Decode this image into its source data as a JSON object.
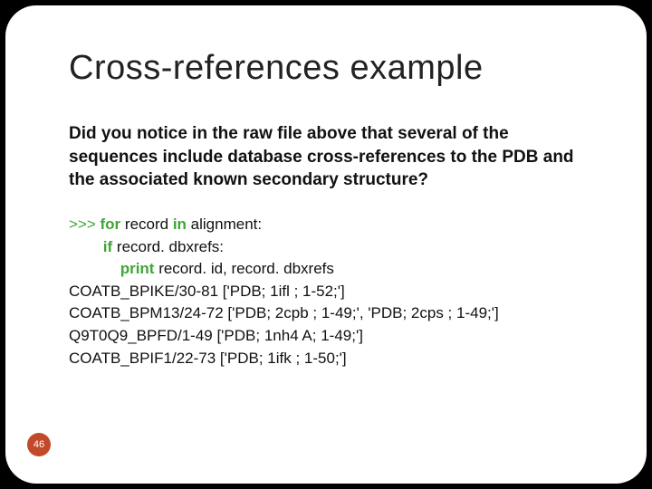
{
  "title": "Cross-references example",
  "intro": "Did you notice in the raw file above that several of the sequences include database cross-references to the PDB and the associated known secondary structure?",
  "code": {
    "prompt": ">>> ",
    "kw_for": "for",
    "loop_mid": " record ",
    "kw_in": "in",
    "loop_tail": " alignment:",
    "kw_if": "if",
    "if_tail": " record. dbxrefs:",
    "kw_print": "print",
    "print_tail": " record. id, record. dbxrefs",
    "out1": "COATB_BPIKE/30-81 ['PDB; 1ifl ; 1-52;']",
    "out2": "COATB_BPM13/24-72 ['PDB; 2cpb ; 1-49;', 'PDB; 2cps ; 1-49;']",
    "out3": "Q9T0Q9_BPFD/1-49 ['PDB; 1nh4 A; 1-49;']",
    "out4": "COATB_BPIF1/22-73 ['PDB; 1ifk ; 1-50;']"
  },
  "page_number": "46"
}
